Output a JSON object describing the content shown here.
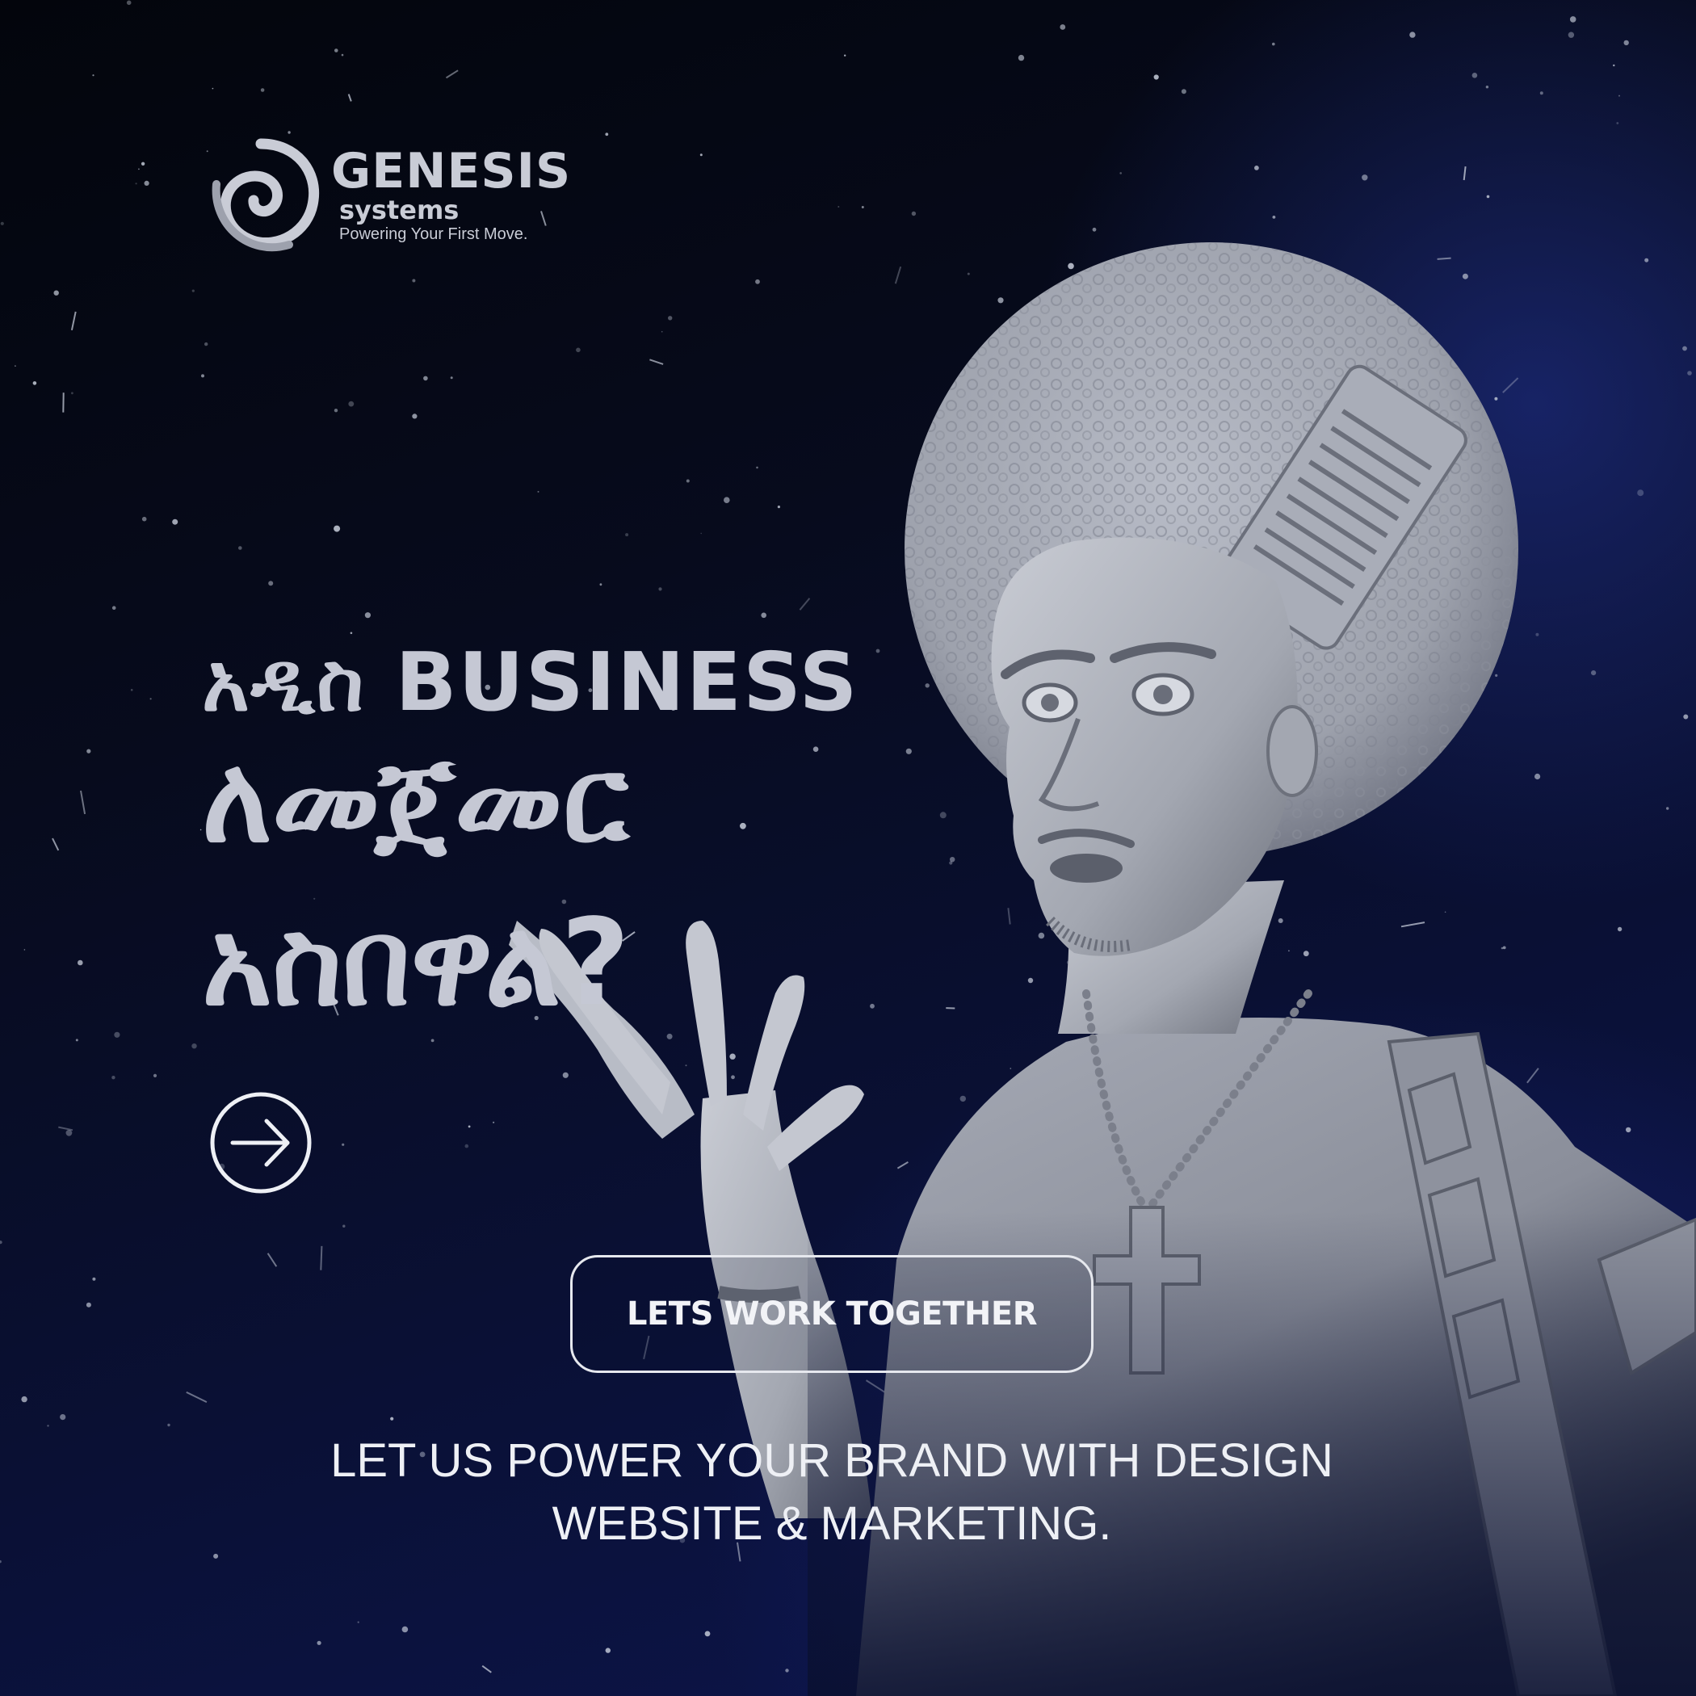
{
  "brand": {
    "name": "GENESIS",
    "sub": "systems",
    "tagline": "Powering Your First Move.",
    "logo_icon": "swirl-icon"
  },
  "headline": {
    "line1": "አዲስ BUSINESS",
    "line2": "ለመጀመር",
    "line3": "አስበዋል?"
  },
  "arrow_icon": "arrow-right-circle-icon",
  "cta": {
    "label": "LETS WORK TOGETHER"
  },
  "description": {
    "line1": "LET US POWER YOUR BRAND WITH DESIGN",
    "line2": "WEBSITE & MARKETING."
  },
  "colors": {
    "background": "#050814",
    "accent_blue": "#0d1650",
    "text": "#c5c8d4",
    "white": "#eef0f5"
  },
  "image": {
    "subject": "figure-illustration"
  }
}
